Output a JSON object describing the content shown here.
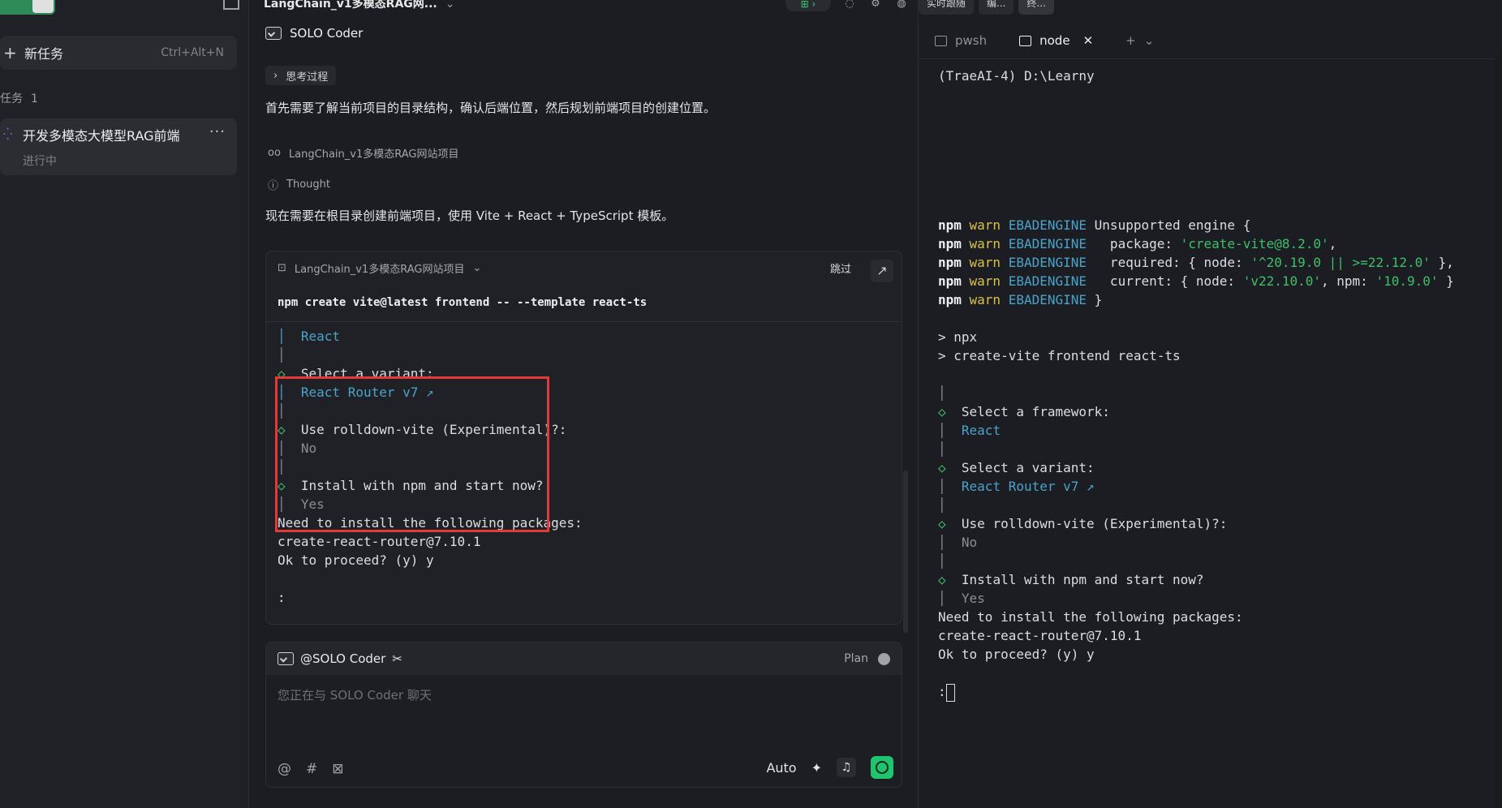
{
  "sidebar": {
    "new_task_label": "新任务",
    "new_task_shortcut": "Ctrl+Alt+N",
    "task_header": "任务",
    "task_count": "1",
    "task_title": "开发多模态大模型RAG前端",
    "task_status": "进行中"
  },
  "chat": {
    "top_title": "LangChain_v1多模态RAG网...",
    "agent_name": "SOLO Coder",
    "think_label": "思考过程",
    "para1": "首先需要了解当前项目的目录结构，确认后端位置，然后规划前端项目的创建位置。",
    "project_link": "LangChain_v1多模态RAG网站项目",
    "thought_label": "Thought",
    "para2": "现在需要在根目录创建前端项目，使用 Vite + React + TypeScript 模板。",
    "terminal_card": {
      "project": "LangChain_v1多模态RAG网站项目",
      "skip": "跳过",
      "command": "npm create vite@latest frontend -- --template react-ts",
      "lines": [
        {
          "text": "│  React",
          "cls": "cyan"
        },
        {
          "text": "│",
          "cls": "dim"
        },
        {
          "text": "◇  Select a variant:",
          "cls": ""
        },
        {
          "text": "│  React Router v7 ↗",
          "cls": "cyan"
        },
        {
          "text": "│",
          "cls": "dim"
        },
        {
          "text": "◇  Use rolldown-vite (Experimental)?:",
          "cls": ""
        },
        {
          "text": "│  No",
          "cls": "dim"
        },
        {
          "text": "│",
          "cls": "dim"
        },
        {
          "text": "◇  Install with npm and start now?",
          "cls": ""
        },
        {
          "text": "│  Yes",
          "cls": "dim"
        },
        {
          "text": "Need to install the following packages:",
          "cls": ""
        },
        {
          "text": "create-react-router@7.10.1",
          "cls": ""
        },
        {
          "text": "Ok to proceed? (y) y",
          "cls": ""
        },
        {
          "text": "",
          "cls": ""
        },
        {
          "text": ":",
          "cls": ""
        }
      ]
    },
    "input": {
      "mention": "@SOLO Coder",
      "plan_label": "Plan",
      "placeholder": "您正在与 SOLO Coder 聊天",
      "mode": "Auto"
    }
  },
  "right_panel": {
    "top_tabs": [
      "实时跟随",
      "编...",
      "终..."
    ],
    "tabs": [
      {
        "label": "pwsh",
        "active": false
      },
      {
        "label": "node",
        "active": true
      }
    ],
    "lines": [
      {
        "segs": [
          {
            "t": "(TraeAI-4) D:\\Learny",
            "c": ""
          }
        ]
      },
      {
        "segs": []
      },
      {
        "segs": []
      },
      {
        "segs": []
      },
      {
        "segs": []
      },
      {
        "segs": []
      },
      {
        "segs": []
      },
      {
        "segs": []
      },
      {
        "segs": [
          {
            "t": "npm ",
            "c": "bold"
          },
          {
            "t": "warn ",
            "c": "warn"
          },
          {
            "t": "EBADENGINE",
            "c": "ebad"
          },
          {
            "t": " Unsupported engine {",
            "c": ""
          }
        ]
      },
      {
        "segs": [
          {
            "t": "npm ",
            "c": "bold"
          },
          {
            "t": "warn ",
            "c": "warn"
          },
          {
            "t": "EBADENGINE",
            "c": "ebad"
          },
          {
            "t": "   package: ",
            "c": ""
          },
          {
            "t": "'create-vite@8.2.0'",
            "c": "str"
          },
          {
            "t": ",",
            "c": ""
          }
        ]
      },
      {
        "segs": [
          {
            "t": "npm ",
            "c": "bold"
          },
          {
            "t": "warn ",
            "c": "warn"
          },
          {
            "t": "EBADENGINE",
            "c": "ebad"
          },
          {
            "t": "   required: { node: ",
            "c": ""
          },
          {
            "t": "'^20.19.0 || >=22.12.0'",
            "c": "str"
          },
          {
            "t": " },",
            "c": ""
          }
        ]
      },
      {
        "segs": [
          {
            "t": "npm ",
            "c": "bold"
          },
          {
            "t": "warn ",
            "c": "warn"
          },
          {
            "t": "EBADENGINE",
            "c": "ebad"
          },
          {
            "t": "   current: { node: ",
            "c": ""
          },
          {
            "t": "'v22.10.0'",
            "c": "str"
          },
          {
            "t": ", npm: ",
            "c": ""
          },
          {
            "t": "'10.9.0'",
            "c": "str"
          },
          {
            "t": " }",
            "c": ""
          }
        ]
      },
      {
        "segs": [
          {
            "t": "npm ",
            "c": "bold"
          },
          {
            "t": "warn ",
            "c": "warn"
          },
          {
            "t": "EBADENGINE",
            "c": "ebad"
          },
          {
            "t": " }",
            "c": ""
          }
        ]
      },
      {
        "segs": []
      },
      {
        "segs": [
          {
            "t": "> npx",
            "c": ""
          }
        ]
      },
      {
        "segs": [
          {
            "t": "> create-vite frontend react-ts",
            "c": ""
          }
        ]
      },
      {
        "segs": []
      },
      {
        "segs": [
          {
            "t": "│",
            "c": "dim"
          }
        ]
      },
      {
        "segs": [
          {
            "t": "◇",
            "c": "grn"
          },
          {
            "t": "  Select a framework:",
            "c": ""
          }
        ]
      },
      {
        "segs": [
          {
            "t": "│  ",
            "c": "dim"
          },
          {
            "t": "React",
            "c": "ebad"
          }
        ]
      },
      {
        "segs": [
          {
            "t": "│",
            "c": "dim"
          }
        ]
      },
      {
        "segs": [
          {
            "t": "◇",
            "c": "grn"
          },
          {
            "t": "  Select a variant:",
            "c": ""
          }
        ]
      },
      {
        "segs": [
          {
            "t": "│  ",
            "c": "dim"
          },
          {
            "t": "React Router v7 ↗",
            "c": "ebad"
          }
        ]
      },
      {
        "segs": [
          {
            "t": "│",
            "c": "dim"
          }
        ]
      },
      {
        "segs": [
          {
            "t": "◇",
            "c": "grn"
          },
          {
            "t": "  Use rolldown-vite (Experimental)?:",
            "c": ""
          }
        ]
      },
      {
        "segs": [
          {
            "t": "│  No",
            "c": "dim"
          }
        ]
      },
      {
        "segs": [
          {
            "t": "│",
            "c": "dim"
          }
        ]
      },
      {
        "segs": [
          {
            "t": "◇",
            "c": "grn"
          },
          {
            "t": "  Install with npm and start now?",
            "c": ""
          }
        ]
      },
      {
        "segs": [
          {
            "t": "│  Yes",
            "c": "dim"
          }
        ]
      },
      {
        "segs": [
          {
            "t": "Need to install the following packages:",
            "c": ""
          }
        ]
      },
      {
        "segs": [
          {
            "t": "create-react-router@7.10.1",
            "c": ""
          }
        ]
      },
      {
        "segs": [
          {
            "t": "Ok to proceed? (y) y",
            "c": ""
          }
        ]
      },
      {
        "segs": []
      },
      {
        "segs": [
          {
            "t": ":",
            "c": ""
          }
        ]
      }
    ]
  },
  "colors": {
    "accent_green": "#1fc56e",
    "highlight_red": "#e53935",
    "link_cyan": "#4aa3c9"
  }
}
